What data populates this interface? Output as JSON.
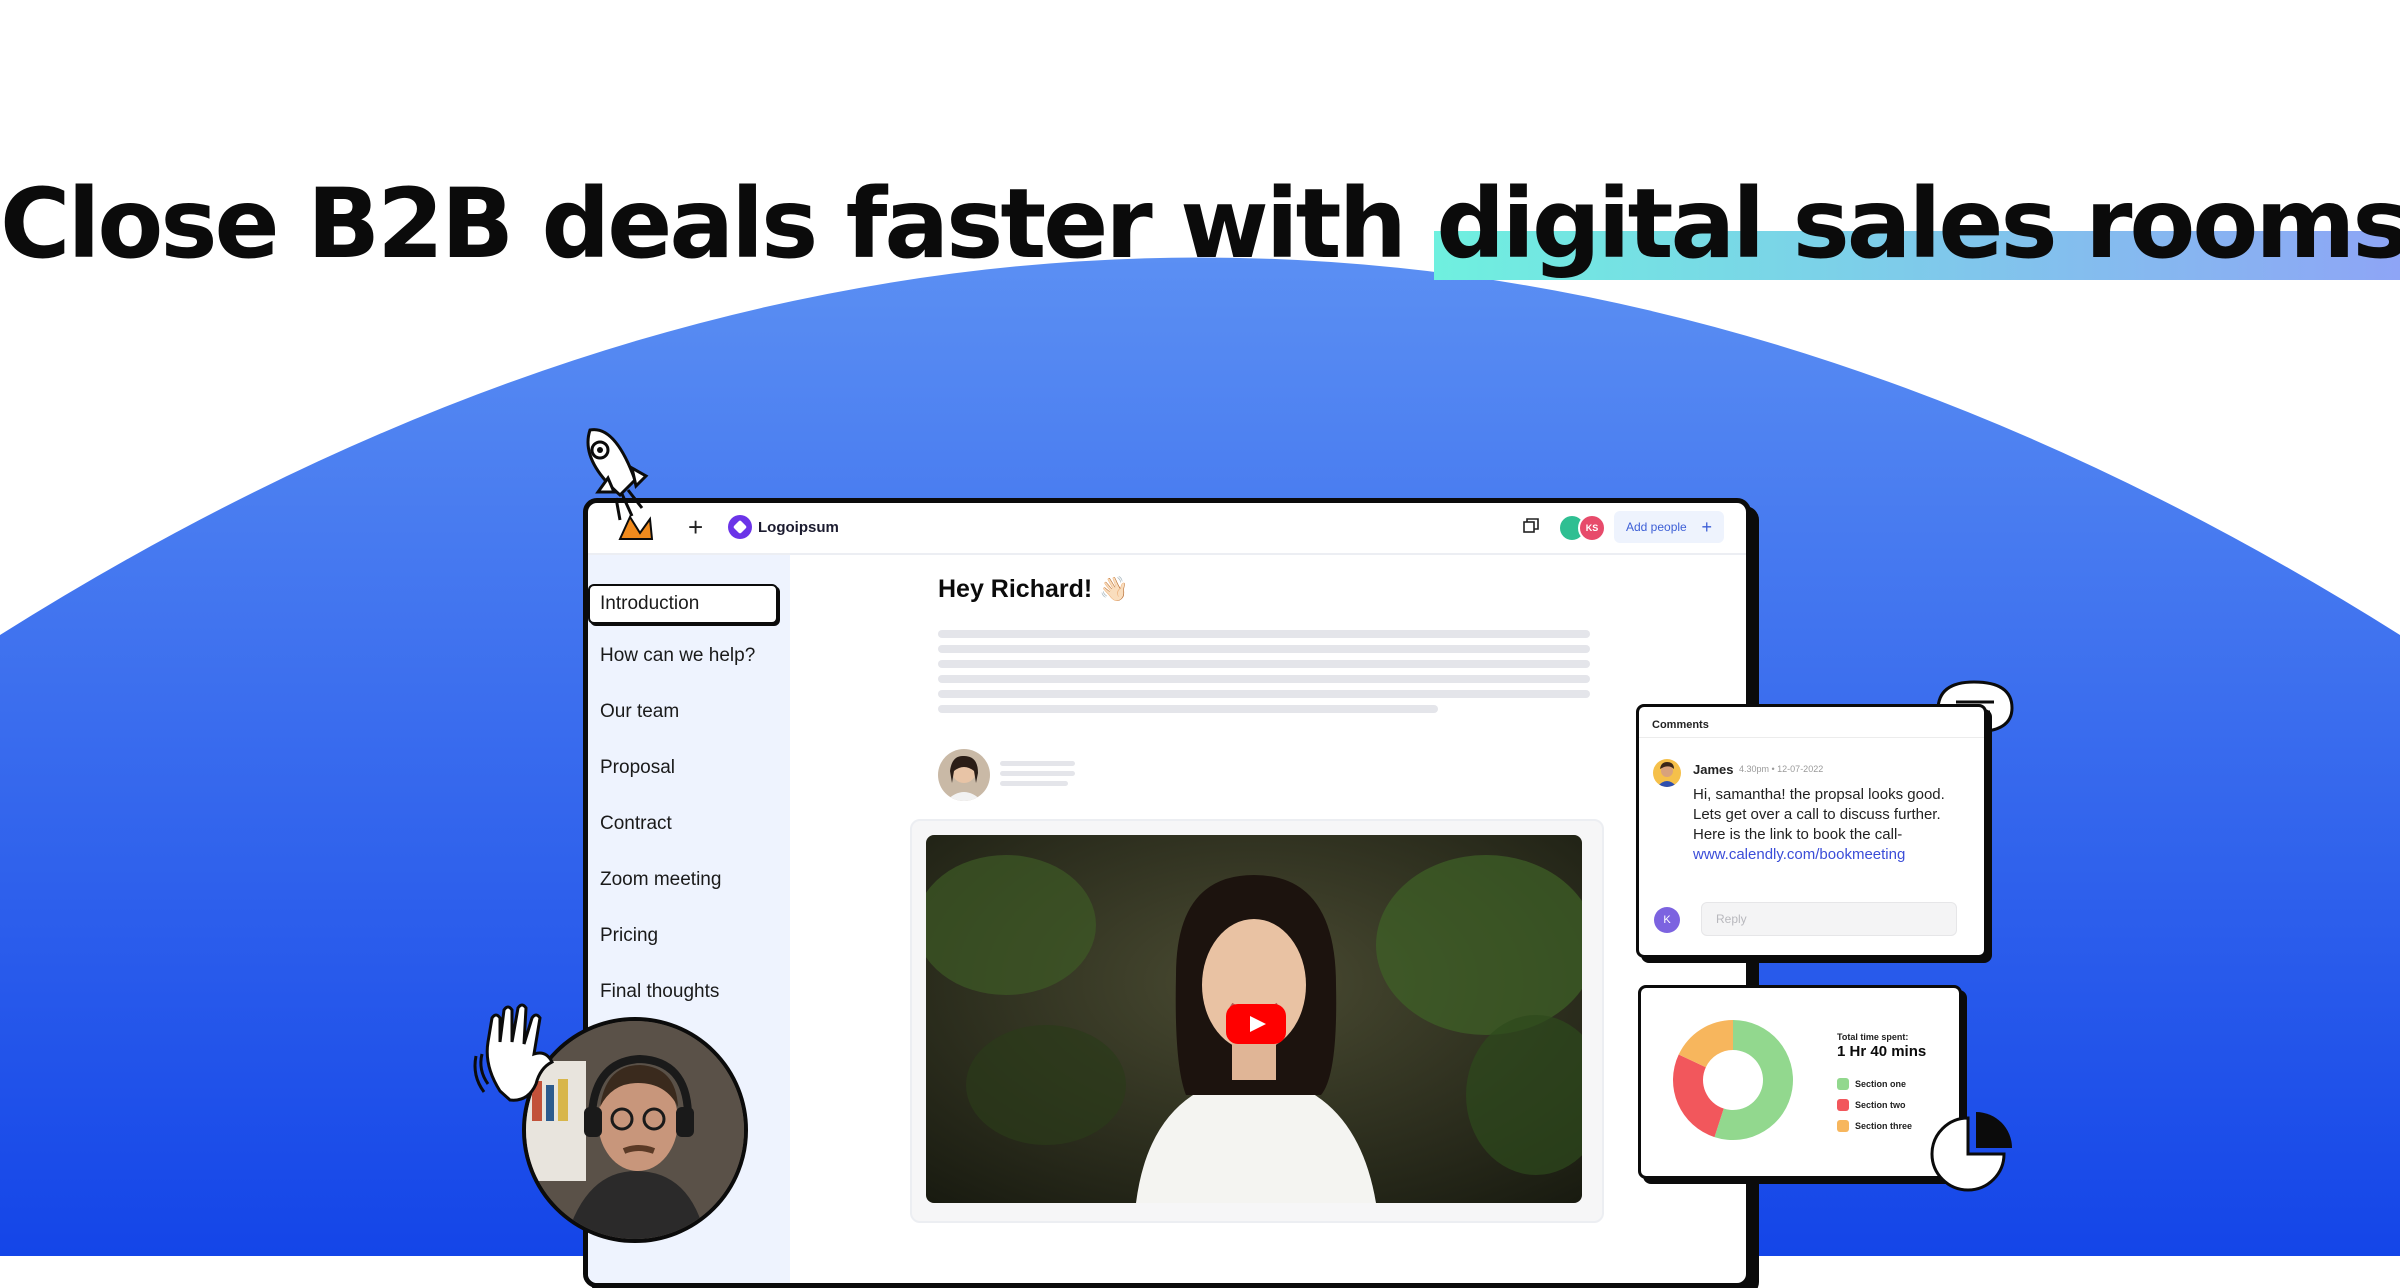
{
  "headline": {
    "prefix": "Close B2B deals faster with ",
    "highlight": "digital sales rooms"
  },
  "colors": {
    "background_blue_top": "#4f86f2",
    "background_blue_bottom": "#1a4fe6",
    "highlight_start": "#6ff0df",
    "highlight_end": "#8ea4f6",
    "logo_accent": "#6b34e8"
  },
  "topbar": {
    "brand_icon": "rocket-brand-icon",
    "plus_icon": "plus-icon",
    "logo_text": "Logoipsum",
    "window_icon": "duplicate-window-icon",
    "avatars": [
      "",
      "KS"
    ],
    "add_people_label": "Add people",
    "add_people_icon": "+"
  },
  "sidebar": {
    "items": [
      {
        "label": "Introduction",
        "active": true
      },
      {
        "label": "How can we help?"
      },
      {
        "label": "Our team"
      },
      {
        "label": "Proposal"
      },
      {
        "label": "Contract"
      },
      {
        "label": "Zoom meeting"
      },
      {
        "label": "Pricing"
      },
      {
        "label": "Final thoughts"
      }
    ]
  },
  "content": {
    "greeting": "Hey Richard!",
    "greeting_emoji": "👋🏻",
    "video_play_icon": "youtube-play-icon"
  },
  "comments": {
    "title": "Comments",
    "author": "James",
    "meta": "4.30pm • 12-07-2022",
    "body": "Hi, samantha! the propsal looks good. Lets get over a call to discuss further. Here is the link to book the call-",
    "link": "www.calendly.com/bookmeeting",
    "reply_avatar": "K",
    "reply_placeholder": "Reply"
  },
  "time_spent": {
    "label": "Total time spent:",
    "value": "1 Hr 40 mins",
    "sections": [
      {
        "name": "Section one",
        "color": "#92d88e",
        "share": 0.55
      },
      {
        "name": "Section two",
        "color": "#f2575c",
        "share": 0.27
      },
      {
        "name": "Section three",
        "color": "#f7b65d",
        "share": 0.18
      }
    ]
  }
}
